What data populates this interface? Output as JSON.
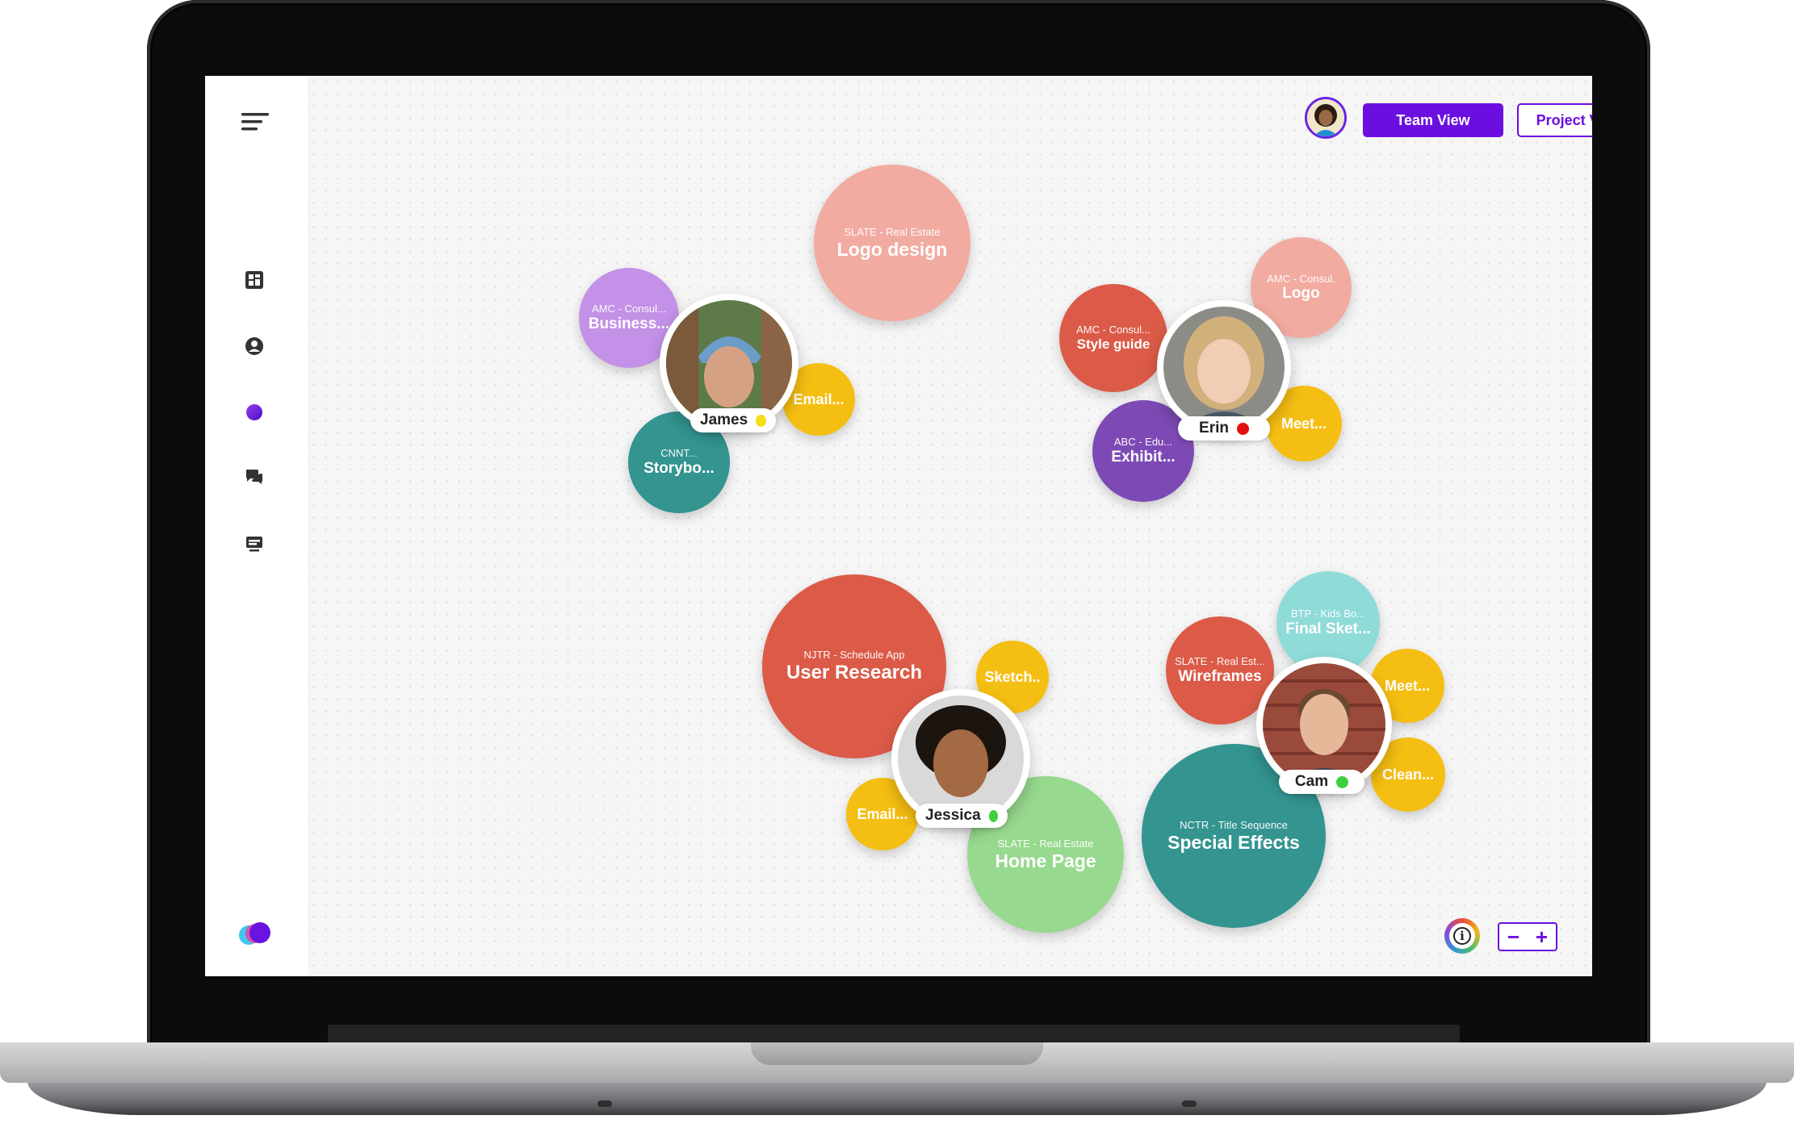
{
  "topbar": {
    "team_view_label": "Team View",
    "project_view_label": "Project View"
  },
  "sidebar": {
    "icons": [
      "menu-icon",
      "dashboard-icon",
      "user-circle-icon",
      "planet-icon",
      "chat-icon",
      "monitor-icon",
      "app-logo-icon"
    ]
  },
  "people": [
    {
      "name": "James",
      "status_color": "#f6dc19"
    },
    {
      "name": "Erin",
      "status_color": "#e01010"
    },
    {
      "name": "Jessica",
      "status_color": "#3fd03f"
    },
    {
      "name": "Cam",
      "status_color": "#3fd03f"
    }
  ],
  "bubbles": {
    "james": [
      {
        "sub": "SLATE - Real Estate",
        "title": "Logo design",
        "color": "#f2aba1"
      },
      {
        "sub": "AMC - Consul...",
        "title": "Business...",
        "color": "#c391e7"
      },
      {
        "sub": "",
        "title": "Email...",
        "color": "#f5be12"
      },
      {
        "sub": "CNNT...",
        "title": "Storybo...",
        "color": "#339490"
      }
    ],
    "erin": [
      {
        "sub": "AMC - Consul.",
        "title": "Logo",
        "color": "#f2aba1"
      },
      {
        "sub": "AMC - Consul...",
        "title": "Style guide",
        "color": "#db5b48"
      },
      {
        "sub": "ABC - Edu...",
        "title": "Exhibit...",
        "color": "#7d4ab5"
      },
      {
        "sub": "",
        "title": "Meet...",
        "color": "#f5be12"
      }
    ],
    "jessica": [
      {
        "sub": "NJTR - Schedule App",
        "title": "User Research",
        "color": "#db5b48"
      },
      {
        "sub": "",
        "title": "Sketch..",
        "color": "#f5be12"
      },
      {
        "sub": "",
        "title": "Email...",
        "color": "#f5be12"
      },
      {
        "sub": "SLATE - Real Estate",
        "title": "Home Page",
        "color": "#97d98e"
      }
    ],
    "cam": [
      {
        "sub": "BTP - Kids Bo...",
        "title": "Final Sket...",
        "color": "#8fdbd8"
      },
      {
        "sub": "SLATE - Real Est...",
        "title": "Wireframes",
        "color": "#db5b48"
      },
      {
        "sub": "",
        "title": "Meet...",
        "color": "#f5be12"
      },
      {
        "sub": "",
        "title": "Clean...",
        "color": "#f5be12"
      },
      {
        "sub": "NCTR - Title Sequence",
        "title": "Special Effects",
        "color": "#339490"
      }
    ]
  },
  "controls": {
    "zoom_out": "−",
    "zoom_in": "+",
    "info_glyph": "i"
  },
  "colors": {
    "accent": "#6a0fe0",
    "canvas_bg": "#f6f6f6"
  }
}
